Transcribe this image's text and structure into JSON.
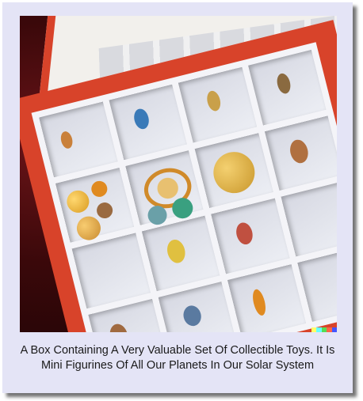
{
  "caption": "A Box Containing A Very Valuable Set Of Collectible Toys. It Is Mini Figurines Of All Our Planets In Our Solar System",
  "colors": {
    "frame": "#e4e4f6",
    "box": "#d8432a",
    "cloth": "#3a080a"
  },
  "watermark_colors": [
    "#ffff66",
    "#66ffff",
    "#55dd55",
    "#ff6644",
    "#4455ff"
  ]
}
